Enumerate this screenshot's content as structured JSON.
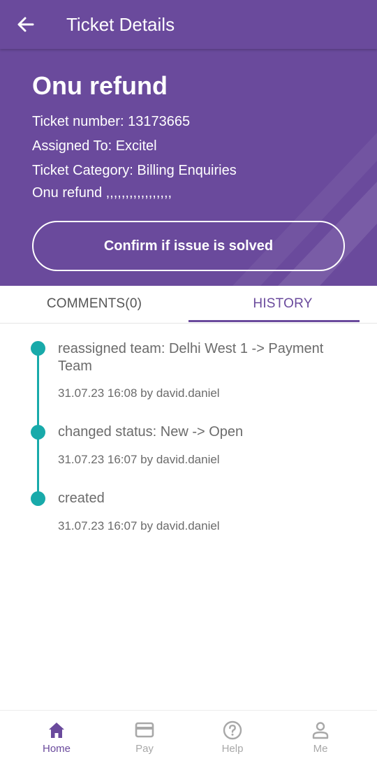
{
  "app_bar": {
    "title": "Ticket Details"
  },
  "ticket": {
    "title": "Onu refund",
    "number_line": "Ticket number: 13173665",
    "assigned_line": "Assigned To: Excitel",
    "category_line": "Ticket Category: Billing Enquiries",
    "description_line": "Onu refund ,,,,,,,,,,,,,,,,,",
    "confirm_label": "Confirm if issue is solved"
  },
  "tabs": [
    {
      "label": "COMMENTS(0)",
      "active": false
    },
    {
      "label": "HISTORY",
      "active": true
    }
  ],
  "history": [
    {
      "text": "reassigned team: Delhi West 1 -> Payment Team",
      "meta": "31.07.23 16:08 by david.daniel"
    },
    {
      "text": "changed status: New -> Open",
      "meta": "31.07.23 16:07 by david.daniel"
    },
    {
      "text": "created",
      "meta": "31.07.23 16:07 by david.daniel"
    }
  ],
  "bottom_nav": [
    {
      "label": "Home",
      "icon": "home-icon",
      "active": true
    },
    {
      "label": "Pay",
      "icon": "card-icon",
      "active": false
    },
    {
      "label": "Help",
      "icon": "help-icon",
      "active": false
    },
    {
      "label": "Me",
      "icon": "person-icon",
      "active": false
    }
  ],
  "colors": {
    "brand_purple": "#6a4a9c",
    "timeline_teal": "#18aaaa",
    "inactive_gray": "#a8a8a8"
  }
}
